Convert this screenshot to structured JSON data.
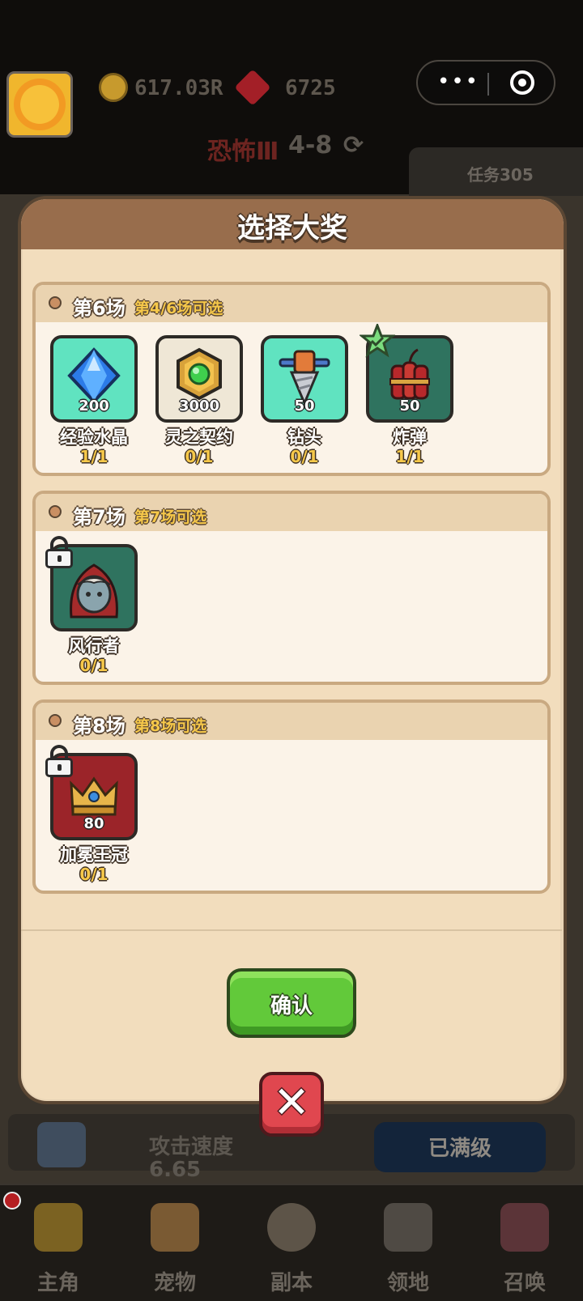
{
  "background": {
    "gold_amount": "617.03R",
    "gem_amount": "6725",
    "stage_difficulty": "恐怖Ⅲ",
    "stage_number": "4-8",
    "mission_label": "任务305",
    "stat_label": "攻击速度",
    "stat_value": "6.65",
    "max_level_label": "已满级",
    "nav": [
      {
        "label": "主角",
        "icon": "crown-icon"
      },
      {
        "label": "宠物",
        "icon": "cat-icon"
      },
      {
        "label": "副本",
        "icon": "dungeon-icon"
      },
      {
        "label": "领地",
        "icon": "tower-icon"
      },
      {
        "label": "召唤",
        "icon": "summon-icon"
      }
    ]
  },
  "dialog": {
    "title": "选择大奖",
    "confirm_label": "确认",
    "close_label": "✕",
    "sections": [
      {
        "title": "第6场",
        "subtitle": "第4/6场可选",
        "items": [
          {
            "name": "经验水晶",
            "value": "200",
            "count": "1/1",
            "icon": "blue-crystal-icon"
          },
          {
            "name": "灵之契约",
            "value": "3000",
            "count": "0/1",
            "icon": "green-orb-contract-icon"
          },
          {
            "name": "钻头",
            "value": "50",
            "count": "0/1",
            "icon": "drill-icon"
          },
          {
            "name": "炸弹",
            "value": "50",
            "count": "1/1",
            "icon": "dynamite-icon"
          }
        ]
      },
      {
        "title": "第7场",
        "subtitle": "第7场可选",
        "items": [
          {
            "name": "风行者",
            "count": "0/1",
            "icon": "windrunner-hero-icon"
          }
        ]
      },
      {
        "title": "第8场",
        "subtitle": "第8场可选",
        "items": [
          {
            "name": "加冕王冠",
            "value": "80",
            "count": "0/1",
            "icon": "crown-icon"
          }
        ]
      }
    ]
  }
}
